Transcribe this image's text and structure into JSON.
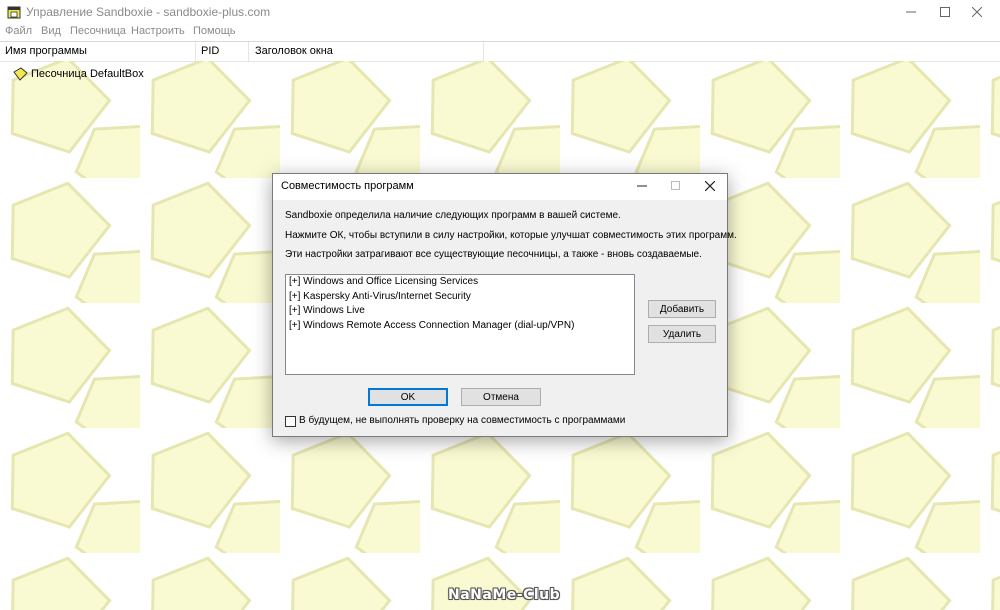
{
  "window": {
    "title": "Управление Sandboxie - sandboxie-plus.com"
  },
  "menu": [
    "Файл",
    "Вид",
    "Песочница",
    "Настроить",
    "Помощь"
  ],
  "columns": [
    "Имя программы",
    "PID",
    "Заголовок окна"
  ],
  "tree": {
    "sandbox_label": "Песочница DefaultBox"
  },
  "dialog": {
    "title": "Совместимость программ",
    "line1": "Sandboxie определила наличие следующих программ в вашей системе.",
    "line2": "Нажмите ОК, чтобы вступили в силу настройки, которые улучшат совместимость этих программ.",
    "line3": "Эти настройки затрагивают все существующие песочницы, а также - вновь создаваемые.",
    "programs": [
      "[+]  Windows and Office Licensing Services",
      "[+]  Kaspersky Anti-Virus/Internet Security",
      "[+]  Windows Live",
      "[+]  Windows Remote Access Connection Manager (dial-up/VPN)"
    ],
    "add_label": "Добавить",
    "remove_label": "Удалить",
    "ok_label": "OK",
    "cancel_label": "Отмена",
    "checkbox_label": "В будущем, не выполнять проверку на совместимость с программами",
    "checkbox_checked": false
  },
  "watermark": "NaNaMe-Club",
  "colors": {
    "pattern_fill": "#fafad2",
    "pattern_stroke": "#e6e6b0",
    "accent": "#0078d7",
    "dialog_bg": "#f0f0f0"
  },
  "icons": [
    "sandboxie-app-icon",
    "minimize-icon",
    "maximize-icon",
    "close-icon",
    "sandbox-icon"
  ]
}
